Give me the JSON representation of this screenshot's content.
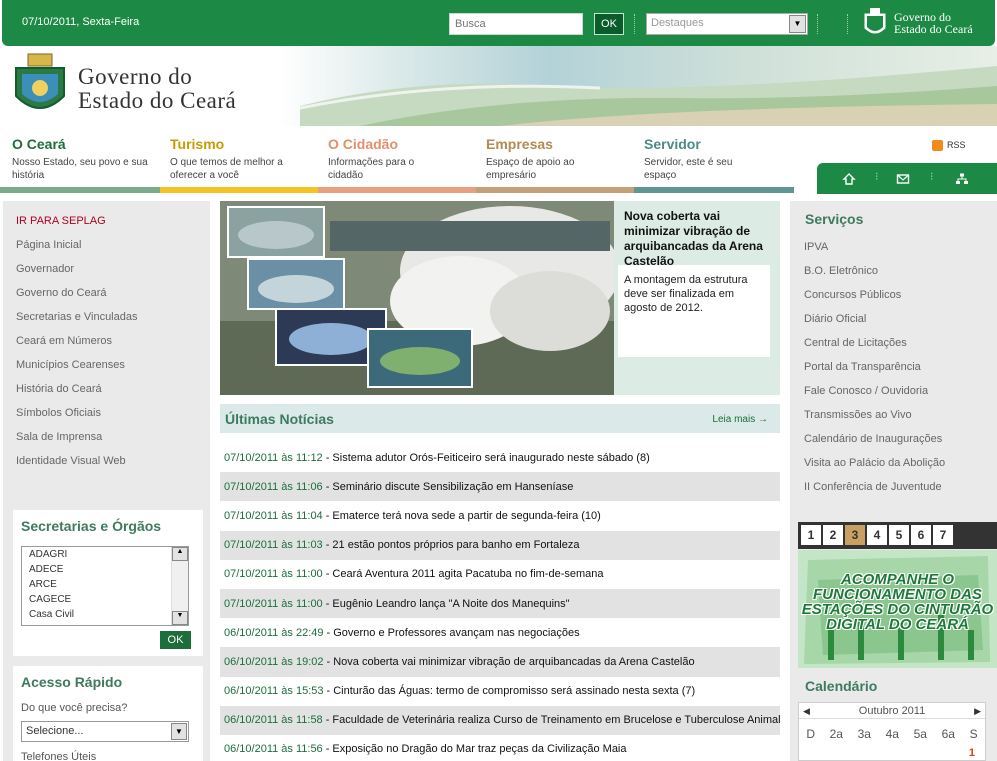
{
  "top": {
    "date": "07/10/2011, Sexta-Feira",
    "search_placeholder": "Busca",
    "search_button": "OK",
    "destaques": "Destaques",
    "logo_line1": "Governo do",
    "logo_line2": "Estado do Ceará"
  },
  "header": {
    "logo_line1": "Governo do",
    "logo_line2": "Estado do Ceará"
  },
  "nav": [
    {
      "label": "O Ceará",
      "sub": "Nosso Estado, seu povo e sua história",
      "color": "#1c6f3a",
      "bar": "#7aab8b"
    },
    {
      "label": "Turismo",
      "sub": "O que temos de melhor a oferecer a você",
      "color": "#c99a06",
      "bar": "#f5c324"
    },
    {
      "label": "O Cidadão",
      "sub": "Informações para o cidadão",
      "color": "#e0906a",
      "bar": "#e9a07e"
    },
    {
      "label": "Empresas",
      "sub": "Espaço de apoio ao empresário",
      "color": "#b38b53",
      "bar": "#c3a077"
    },
    {
      "label": "Servidor",
      "sub": "Servidor, este é seu espaço",
      "color": "#4f8a86",
      "bar": "#5f9693"
    }
  ],
  "rss": "RSS",
  "left_menu": [
    "IR PARA SEPLAG",
    "Página Inicial",
    "Governador",
    "Governo do Ceará",
    "Secretarias e Vinculadas",
    "Ceará em Números",
    "Municípios Cearenses",
    "História do Ceará",
    "Símbolos Oficiais",
    "Sala de Imprensa",
    "Identidade Visual Web"
  ],
  "secretarias": {
    "title": "Secretarias e Órgãos",
    "items": [
      "ADAGRI",
      "ADECE",
      "ARCE",
      "CAGECE",
      "Casa Civil"
    ],
    "ok": "OK"
  },
  "acesso": {
    "title": "Acesso Rápido",
    "question": "Do que você precisa?",
    "selected": "Selecione...",
    "tel": "Telefones Úteis"
  },
  "feature": {
    "title": "Nova coberta vai minimizar vibração de arquibancadas da Arena Castelão",
    "desc": "A montagem da estrutura deve ser finalizada em agosto de 2012."
  },
  "news": {
    "title": "Últimas Notícias",
    "more": "Leia mais →",
    "items": [
      {
        "date": "07/10/2011 às 11:12",
        "text": "- Sistema adutor Orós-Feiticeiro será inaugurado neste sábado (8)"
      },
      {
        "date": "07/10/2011 às 11:06",
        "text": "- Seminário discute Sensibilização em Hanseníase"
      },
      {
        "date": "07/10/2011 às 11:04",
        "text": "- Ematerce terá nova sede a partir de segunda-feira (10)"
      },
      {
        "date": "07/10/2011 às 11:03",
        "text": "- 21 estão pontos próprios para banho em Fortaleza"
      },
      {
        "date": "07/10/2011 às 11:00",
        "text": "- Ceará Aventura 2011 agita Pacatuba no fim-de-semana"
      },
      {
        "date": "07/10/2011 às 11:00",
        "text": "- Eugênio Leandro lança \"A Noite dos Manequins\""
      },
      {
        "date": "06/10/2011 às 22:49",
        "text": "- Governo e Professores avançam nas negociações"
      },
      {
        "date": "06/10/2011 às 19:02",
        "text": "- Nova coberta vai minimizar vibração de arquibancadas da Arena Castelão"
      },
      {
        "date": "06/10/2011 às 15:53",
        "text": "- Cinturão das Águas: termo de compromisso será assinado nesta sexta (7)"
      },
      {
        "date": "06/10/2011 às 11:58",
        "text": "- Faculdade de Veterinária realiza Curso de Treinamento em Brucelose e Tuberculose Animal"
      },
      {
        "date": "06/10/2011 às 11:56",
        "text": "- Exposição no Dragão do Mar traz peças da Civilização Maia"
      }
    ]
  },
  "servicos": {
    "title": "Serviços",
    "items": [
      "IPVA",
      "B.O. Eletrônico",
      "Concursos Públicos",
      "Diário Oficial",
      "Central de Licitações",
      "Portal da Transparência",
      "Fale Conosco / Ouvidoria",
      "Transmissões ao Vivo",
      "Calendário de Inaugurações",
      "Visita ao Palácio da Abolição",
      "II Conferência de Juventude"
    ]
  },
  "pager": {
    "pages": [
      "1",
      "2",
      "3",
      "4",
      "5",
      "6",
      "7"
    ],
    "active": "3"
  },
  "banner": "ACOMPANHE O FUNCIONAMENTO DAS ESTAÇÕES DO CINTURÃO DIGITAL DO CEARÁ",
  "calendar": {
    "title": "Calendário",
    "month": "Outubro 2011",
    "days": [
      "D",
      "2a",
      "3a",
      "4a",
      "5a",
      "6a",
      "S"
    ],
    "first": "1"
  }
}
